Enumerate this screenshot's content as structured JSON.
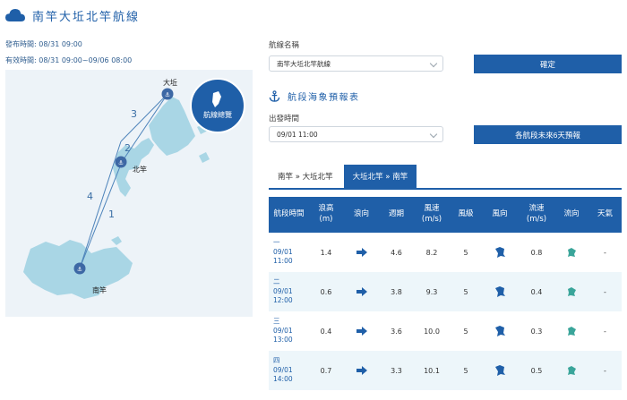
{
  "page": {
    "title": "南竿大坵北竿航線",
    "publish_time": "發布時間: 08/31 09:00",
    "valid_time": "有效時間: 08/31 09:00~09/06 08:00"
  },
  "map": {
    "places": {
      "dakiu": "大坵",
      "beigan": "北竿",
      "nangan": "南竿"
    },
    "route_numbers": [
      "1",
      "2",
      "3",
      "4"
    ],
    "overview_button": "航線總覽"
  },
  "form": {
    "route_label": "航線名稱",
    "route_value": "南竿大坵北竿航線",
    "confirm_button": "確定",
    "section_title": "航段海象預報表",
    "depart_label": "出發時間",
    "depart_value": "09/01 11:00",
    "forecast_button": "各航段未來6天預報"
  },
  "tabs": [
    {
      "label": "南竿 » 大坵北竿",
      "active": false
    },
    {
      "label": "大坵北竿 » 南竿",
      "active": true
    }
  ],
  "table": {
    "headers": [
      "航段時間",
      "浪高\n(m)",
      "浪向",
      "週期",
      "風速\n(m/s)",
      "風級",
      "風向",
      "流速\n(m/s)",
      "流向",
      "天氣"
    ],
    "rows": [
      {
        "seg": "一",
        "date": "09/01",
        "time": "11:00",
        "wave_h": "1.4",
        "period": "4.6",
        "wind_speed": "8.2",
        "wind_level": "5",
        "current": "0.8",
        "weather": "-"
      },
      {
        "seg": "二",
        "date": "09/01",
        "time": "12:00",
        "wave_h": "0.6",
        "period": "3.8",
        "wind_speed": "9.3",
        "wind_level": "5",
        "current": "0.4",
        "weather": "-"
      },
      {
        "seg": "三",
        "date": "09/01",
        "time": "13:00",
        "wave_h": "0.4",
        "period": "3.6",
        "wind_speed": "10.0",
        "wind_level": "5",
        "current": "0.3",
        "weather": "-"
      },
      {
        "seg": "四",
        "date": "09/01",
        "time": "14:00",
        "wave_h": "0.7",
        "period": "3.3",
        "wind_speed": "10.1",
        "wind_level": "5",
        "current": "0.5",
        "weather": "-"
      }
    ]
  },
  "icons": {
    "title": "cloud-icon",
    "section": "anchor-icon",
    "wave_direction": "arrow-icon",
    "wind_direction": "wind-direction-icon",
    "current_direction": "current-direction-icon"
  },
  "colors": {
    "primary": "#1f5fa8",
    "map_land": "#a9d6e5",
    "map_bg": "#edf3f8",
    "current_teal": "#3aa59a"
  }
}
